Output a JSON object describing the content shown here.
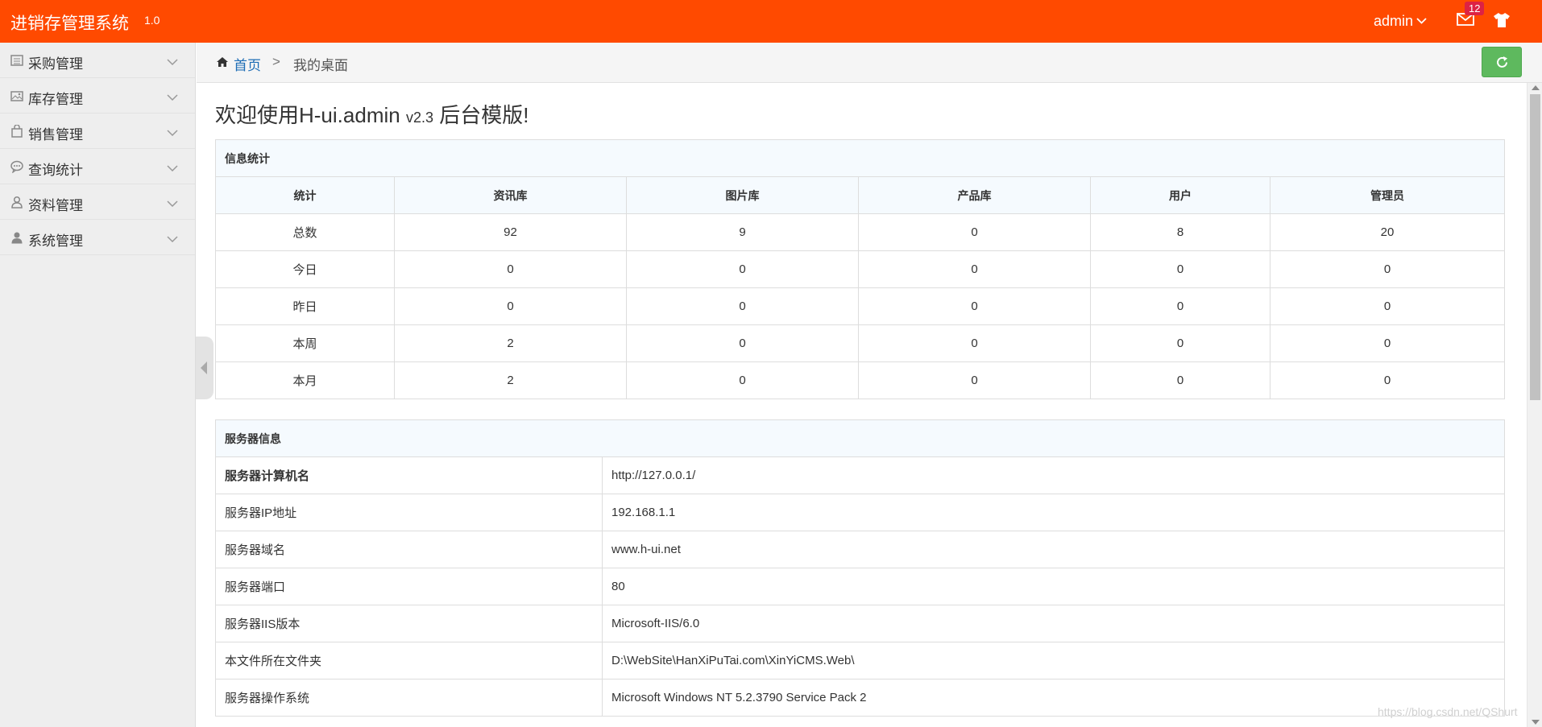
{
  "header": {
    "app_title": "进销存管理系统",
    "app_version": "1.0",
    "user": "admin",
    "message_count": "12",
    "icons": [
      "mail-icon",
      "tshirt-icon",
      "chevron-down-icon"
    ],
    "accent_color": "#ff4a00"
  },
  "sidebar": {
    "items": [
      {
        "label": "采购管理",
        "icon": "list-icon"
      },
      {
        "label": "库存管理",
        "icon": "image-icon"
      },
      {
        "label": "销售管理",
        "icon": "bag-icon"
      },
      {
        "label": "查询统计",
        "icon": "chat-icon"
      },
      {
        "label": "资料管理",
        "icon": "user-outline-icon"
      },
      {
        "label": "系统管理",
        "icon": "user-icon"
      }
    ]
  },
  "breadcrumb": {
    "home": "首页",
    "separator": ">",
    "current": "我的桌面"
  },
  "welcome": {
    "text": "欢迎使用H-ui.admin",
    "version": "v2.3",
    "suffix": "后台模版!"
  },
  "stats": {
    "caption": "信息统计",
    "headers": [
      "统计",
      "资讯库",
      "图片库",
      "产品库",
      "用户",
      "管理员"
    ],
    "rows": [
      [
        "总数",
        "92",
        "9",
        "0",
        "8",
        "20"
      ],
      [
        "今日",
        "0",
        "0",
        "0",
        "0",
        "0"
      ],
      [
        "昨日",
        "0",
        "0",
        "0",
        "0",
        "0"
      ],
      [
        "本周",
        "2",
        "0",
        "0",
        "0",
        "0"
      ],
      [
        "本月",
        "2",
        "0",
        "0",
        "0",
        "0"
      ]
    ]
  },
  "server": {
    "caption": "服务器信息",
    "rows": [
      [
        "服务器计算机名",
        "http://127.0.0.1/"
      ],
      [
        "服务器IP地址",
        "192.168.1.1"
      ],
      [
        "服务器域名",
        "www.h-ui.net"
      ],
      [
        "服务器端口",
        "80"
      ],
      [
        "服务器IIS版本",
        "Microsoft-IIS/6.0"
      ],
      [
        "本文件所在文件夹",
        "D:\\WebSite\\HanXiPuTai.com\\XinYiCMS.Web\\"
      ],
      [
        "服务器操作系统",
        "Microsoft Windows NT 5.2.3790 Service Pack 2"
      ]
    ]
  },
  "watermark": "https://blog.csdn.net/QShurt"
}
